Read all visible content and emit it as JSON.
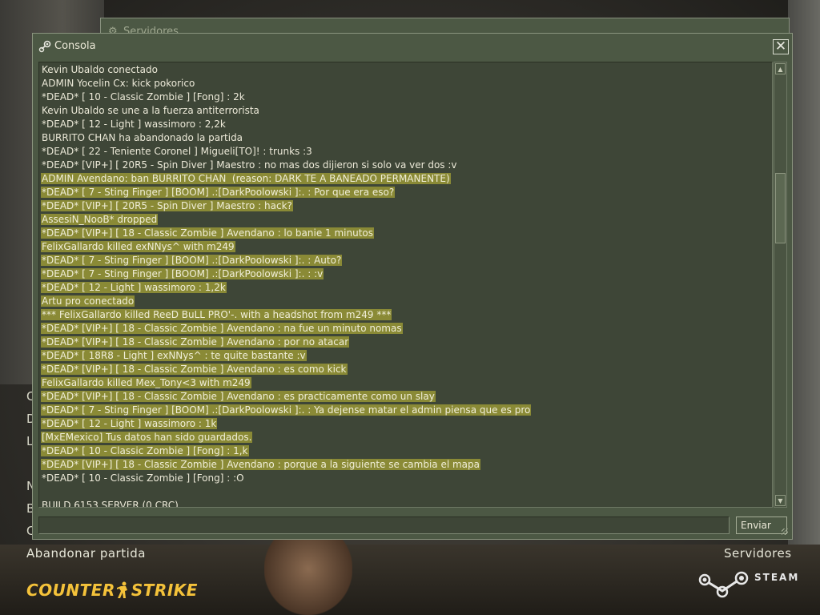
{
  "back_window": {
    "title": "Servidores"
  },
  "console": {
    "title": "Consola",
    "close_label": "✕",
    "send_label": "Enviar",
    "input_value": "",
    "lines": [
      {
        "text": "Kevin Ubaldo conectado",
        "hl": false
      },
      {
        "text": "ADMIN Yocelin Cx: kick pokorico",
        "hl": false
      },
      {
        "text": "*DEAD* [ 10 - Classic Zombie ] [Fong] : 2k",
        "hl": false
      },
      {
        "text": "Kevin Ubaldo se une a la fuerza antiterrorista",
        "hl": false
      },
      {
        "text": "*DEAD* [ 12 - Light ] wassimoro : 2,2k",
        "hl": false
      },
      {
        "text": "BURRITO CHAN ha abandonado la partida",
        "hl": false
      },
      {
        "text": "*DEAD* [ 22 - Teniente Coronel ] Migueli[TO]! : trunks :3",
        "hl": false
      },
      {
        "text": "*DEAD* [VIP+] [ 20R5 - Spin Diver ] Maestro : no mas dos dijieron si solo va ver dos :v",
        "hl": false
      },
      {
        "text": "ADMIN Avendano: ban BURRITO CHAN  (reason: DARK TE A BANEADO PERMANENTE)",
        "hl": true
      },
      {
        "text": "*DEAD* [ 7 - Sting Finger ] [BOOM] .:[DarkPoolowski ]:. : Por que era eso?",
        "hl": true
      },
      {
        "text": "*DEAD* [VIP+] [ 20R5 - Spin Diver ] Maestro : hack?",
        "hl": true
      },
      {
        "text": "AssesiN_NooB* dropped",
        "hl": true
      },
      {
        "text": "*DEAD* [VIP+] [ 18 - Classic Zombie ] Avendano : lo banie 1 minutos",
        "hl": true
      },
      {
        "text": "FelixGallardo killed exNNys^ with m249",
        "hl": true
      },
      {
        "text": "*DEAD* [ 7 - Sting Finger ] [BOOM] .:[DarkPoolowski ]:. : Auto?",
        "hl": true
      },
      {
        "text": "*DEAD* [ 7 - Sting Finger ] [BOOM] .:[DarkPoolowski ]:. : :v",
        "hl": true
      },
      {
        "text": "*DEAD* [ 12 - Light ] wassimoro : 1,2k",
        "hl": true
      },
      {
        "text": "Artu pro conectado",
        "hl": true
      },
      {
        "text": "*** FelixGallardo killed ReeD BuLL PRO'-. with a headshot from m249 ***",
        "hl": true
      },
      {
        "text": "*DEAD* [VIP+] [ 18 - Classic Zombie ] Avendano : na fue un minuto nomas",
        "hl": true
      },
      {
        "text": "*DEAD* [VIP+] [ 18 - Classic Zombie ] Avendano : por no atacar",
        "hl": true
      },
      {
        "text": "*DEAD* [ 18R8 - Light ] exNNys^ : te quite bastante :v",
        "hl": true
      },
      {
        "text": "*DEAD* [VIP+] [ 18 - Classic Zombie ] Avendano : es como kick",
        "hl": true
      },
      {
        "text": "FelixGallardo killed Mex_Tony<3 with m249",
        "hl": true
      },
      {
        "text": "*DEAD* [VIP+] [ 18 - Classic Zombie ] Avendano : es practicamente como un slay",
        "hl": true
      },
      {
        "text": "*DEAD* [ 7 - Sting Finger ] [BOOM] .:[DarkPoolowski ]:. : Ya dejense matar el admin piensa que es pro",
        "hl": true
      },
      {
        "text": "*DEAD* [ 12 - Light ] wassimoro : 1k",
        "hl": true
      },
      {
        "text": "[MxEMexico] Tus datos han sido guardados.",
        "hl": true
      },
      {
        "text": "*DEAD* [ 10 - Classic Zombie ] [Fong] : 1,k",
        "hl": true
      },
      {
        "text": "*DEAD* [VIP+] [ 18 - Classic Zombie ] Avendano : porque a la siguiente se cambia el mapa",
        "hl": true
      },
      {
        "text": "*DEAD* [ 10 - Classic Zombie ] [Fong] : :O",
        "hl": false
      },
      {
        "text": "",
        "hl": false
      },
      {
        "text": "BUILD 6153 SERVER (0 CRC)",
        "hl": false
      }
    ]
  },
  "menu": {
    "clipped_letters": [
      "C",
      "D",
      "L",
      "N",
      "B",
      "C"
    ],
    "abandon": "Abandonar partida",
    "servers": "Servidores"
  },
  "logos": {
    "game_left": "COUNTER",
    "game_right": "STRIKE",
    "platform": "STEAM",
    "game_color": "#f4c23a"
  }
}
